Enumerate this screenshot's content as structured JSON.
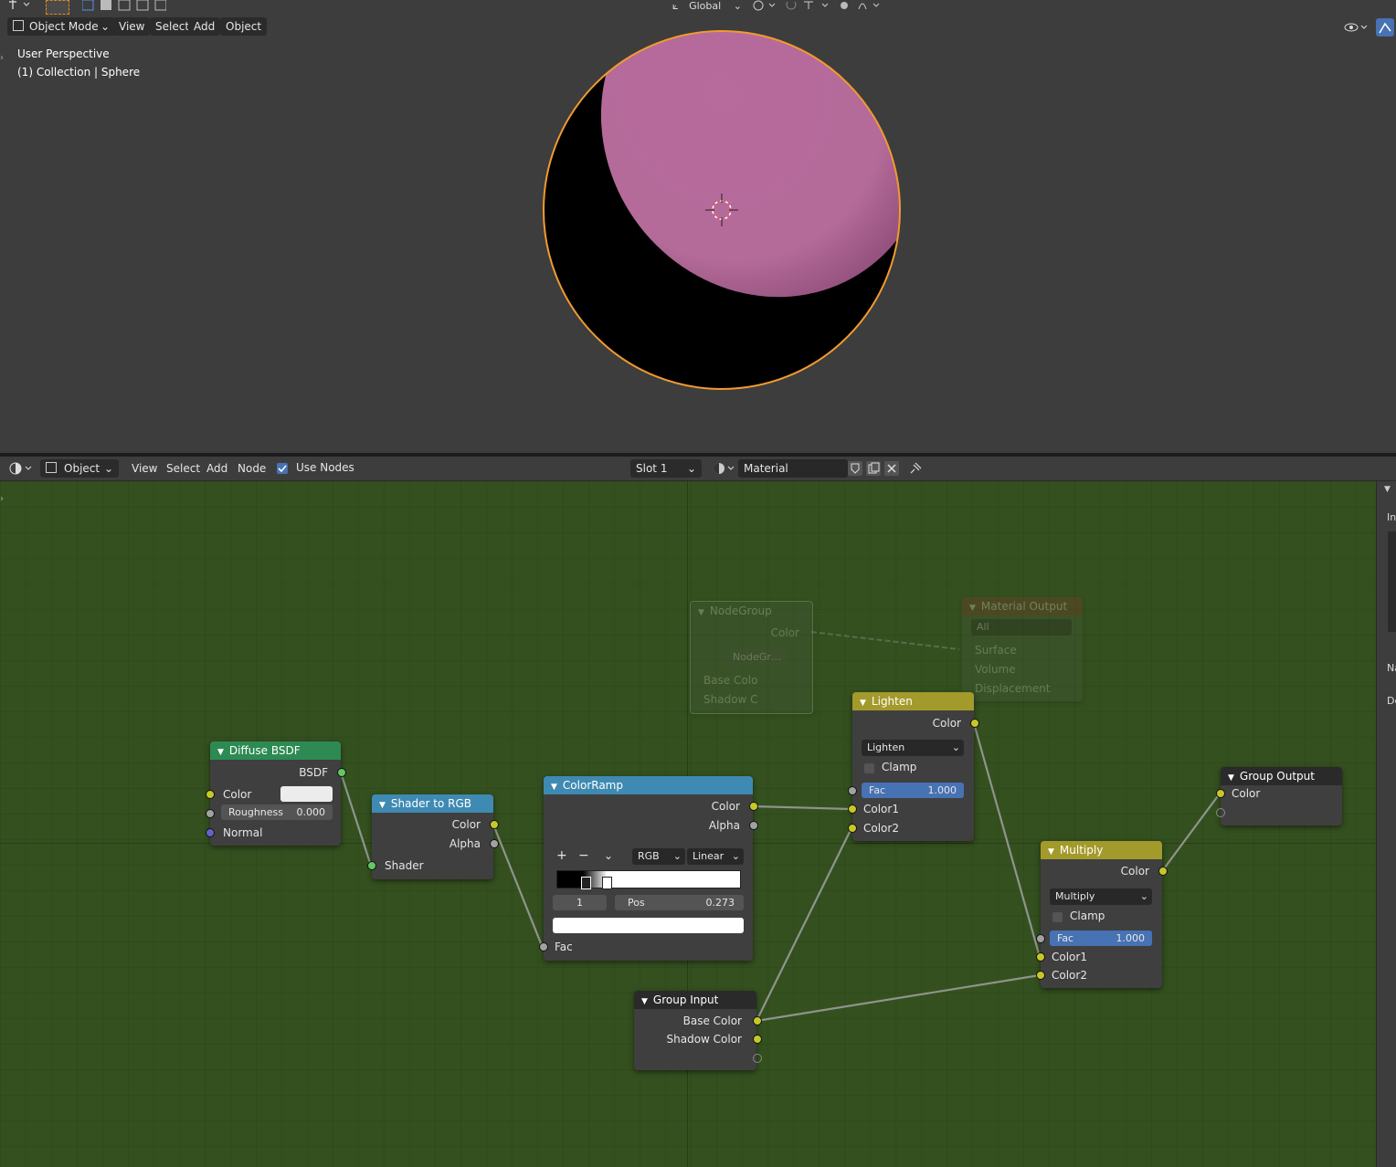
{
  "viewport": {
    "mode_label": "Object Mode",
    "menus": [
      "View",
      "Select",
      "Add",
      "Object"
    ],
    "transform_orientation": "Global",
    "overlay_title": "User Perspective",
    "overlay_collection": "(1) Collection | Sphere"
  },
  "node_editor": {
    "editor_type_label": "Object",
    "menus": [
      "View",
      "Select",
      "Add",
      "Node"
    ],
    "use_nodes_label": "Use Nodes",
    "slot_label": "Slot 1",
    "material_name": "Material",
    "side_labels": [
      "In",
      "Na",
      "De"
    ]
  },
  "nodes": {
    "diffuse": {
      "title": "Diffuse BSDF",
      "out_bsdf": "BSDF",
      "color_label": "Color",
      "roughness_label": "Roughness",
      "roughness_value": "0.000",
      "normal_label": "Normal"
    },
    "shader_to_rgb": {
      "title": "Shader to RGB",
      "out_color": "Color",
      "out_alpha": "Alpha",
      "in_shader": "Shader"
    },
    "colorramp": {
      "title": "ColorRamp",
      "out_color": "Color",
      "out_alpha": "Alpha",
      "plus": "+",
      "minus": "−",
      "mode": "RGB",
      "interp": "Linear",
      "index": "1",
      "pos_label": "Pos",
      "pos_value": "0.273",
      "in_fac": "Fac"
    },
    "lighten": {
      "title": "Lighten",
      "out_color": "Color",
      "blend": "Lighten",
      "clamp": "Clamp",
      "fac_label": "Fac",
      "fac_value": "1.000",
      "color1": "Color1",
      "color2": "Color2"
    },
    "multiply": {
      "title": "Multiply",
      "out_color": "Color",
      "blend": "Multiply",
      "clamp": "Clamp",
      "fac_label": "Fac",
      "fac_value": "1.000",
      "color1": "Color1",
      "color2": "Color2"
    },
    "group_input": {
      "title": "Group Input",
      "base_color": "Base Color",
      "shadow_color": "Shadow Color"
    },
    "group_output": {
      "title": "Group Output",
      "color": "Color"
    },
    "ghost_nodegroup": {
      "title": "NodeGroup",
      "out_color": "Color",
      "group_name": "NodeGr…",
      "base": "Base Colo",
      "shadow": "Shadow C"
    },
    "ghost_material_output": {
      "title": "Material Output",
      "target": "All",
      "surface": "Surface",
      "volume": "Volume",
      "displacement": "Displacement"
    }
  }
}
